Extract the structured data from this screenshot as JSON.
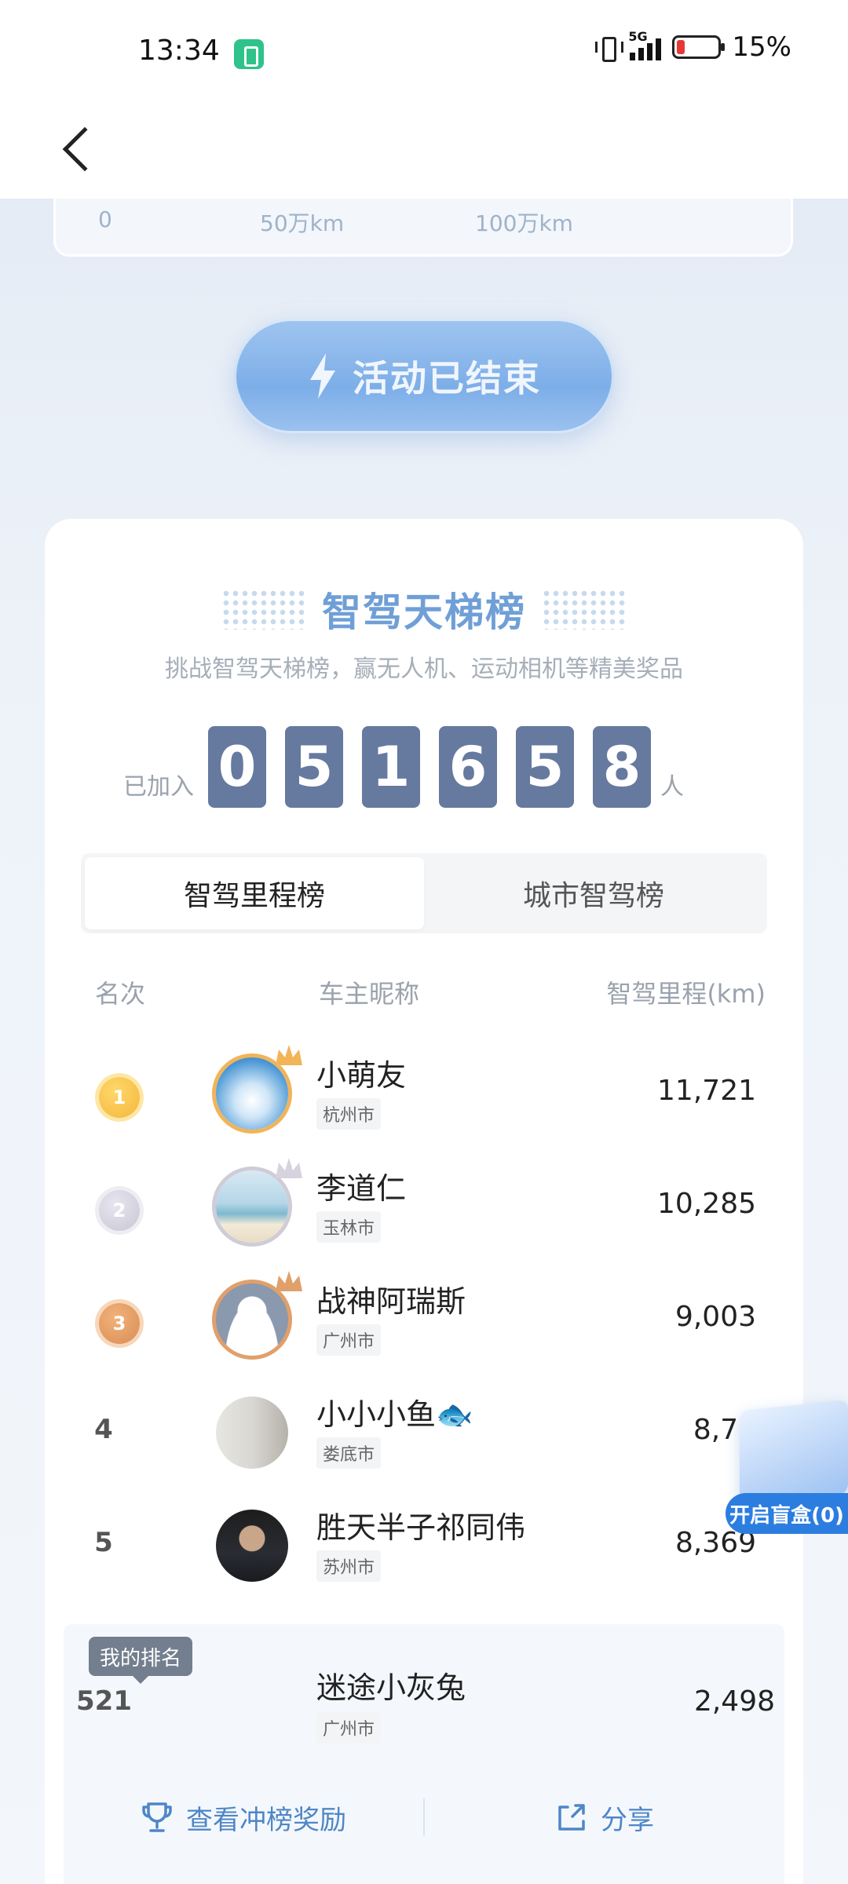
{
  "status_bar": {
    "time": "13:34",
    "network": "5G",
    "battery": "15%"
  },
  "progress_card": {
    "labels": [
      "0",
      "50万km",
      "100万km"
    ]
  },
  "ended_button": {
    "label": "活动已结束"
  },
  "ladder": {
    "title": "智驾天梯榜",
    "subtitle": "挑战智驾天梯榜，赢无人机、运动相机等精美奖品",
    "joined_prefix": "已加入",
    "joined_digits": [
      "0",
      "5",
      "1",
      "6",
      "5",
      "8"
    ],
    "joined_suffix": "人"
  },
  "tabs": [
    {
      "label": "智驾里程榜",
      "active": true
    },
    {
      "label": "城市智驾榜",
      "active": false
    }
  ],
  "columns": {
    "rank": "名次",
    "nickname": "车主昵称",
    "mileage": "智驾里程(km)"
  },
  "rows": [
    {
      "rank": "1",
      "name": "小萌友",
      "city": "杭州市",
      "mileage": "11,721"
    },
    {
      "rank": "2",
      "name": "李道仁",
      "city": "玉林市",
      "mileage": "10,285"
    },
    {
      "rank": "3",
      "name": "战神阿瑞斯",
      "city": "广州市",
      "mileage": "9,003"
    },
    {
      "rank": "4",
      "name": "小小小鱼🐟",
      "city": "娄底市",
      "mileage": "8,76"
    },
    {
      "rank": "5",
      "name": "胜天半子祁同伟",
      "city": "苏州市",
      "mileage": "8,369"
    }
  ],
  "my_rank": {
    "badge": "我的排名",
    "rank": "521",
    "name": "迷途小灰兔",
    "city": "广州市",
    "mileage": "2,498"
  },
  "actions": {
    "rewards": "查看冲榜奖励",
    "share": "分享"
  },
  "blind_box": {
    "label": "开启盲盒(0)"
  },
  "colors": {
    "accent": "#4f86c6",
    "digit_bg": "#66799f",
    "title": "#6f9fd6"
  }
}
